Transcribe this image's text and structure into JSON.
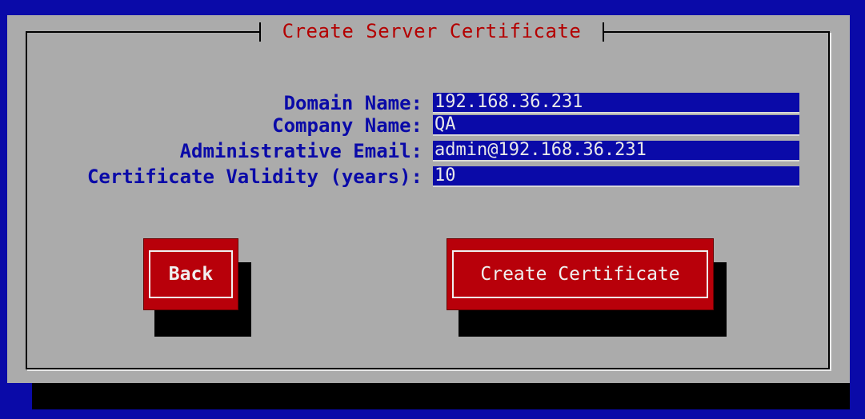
{
  "dialog": {
    "title": "Create Server Certificate"
  },
  "form": {
    "fields": [
      {
        "label": "Domain Name:",
        "value": "192.168.36.231"
      },
      {
        "label": "Company Name:",
        "value": "QA"
      },
      {
        "label": "Administrative Email:",
        "value": "admin@192.168.36.231"
      },
      {
        "label": "Certificate Validity (years):",
        "value": "10"
      }
    ]
  },
  "buttons": {
    "back_label": "Back",
    "create_label": "Create Certificate"
  },
  "colors": {
    "background": "#0a0aa8",
    "dialog": "#ababab",
    "title": "#b40000",
    "button": "#b8000a",
    "label": "#0a0aa8",
    "input_text": "#e8e8e8"
  }
}
